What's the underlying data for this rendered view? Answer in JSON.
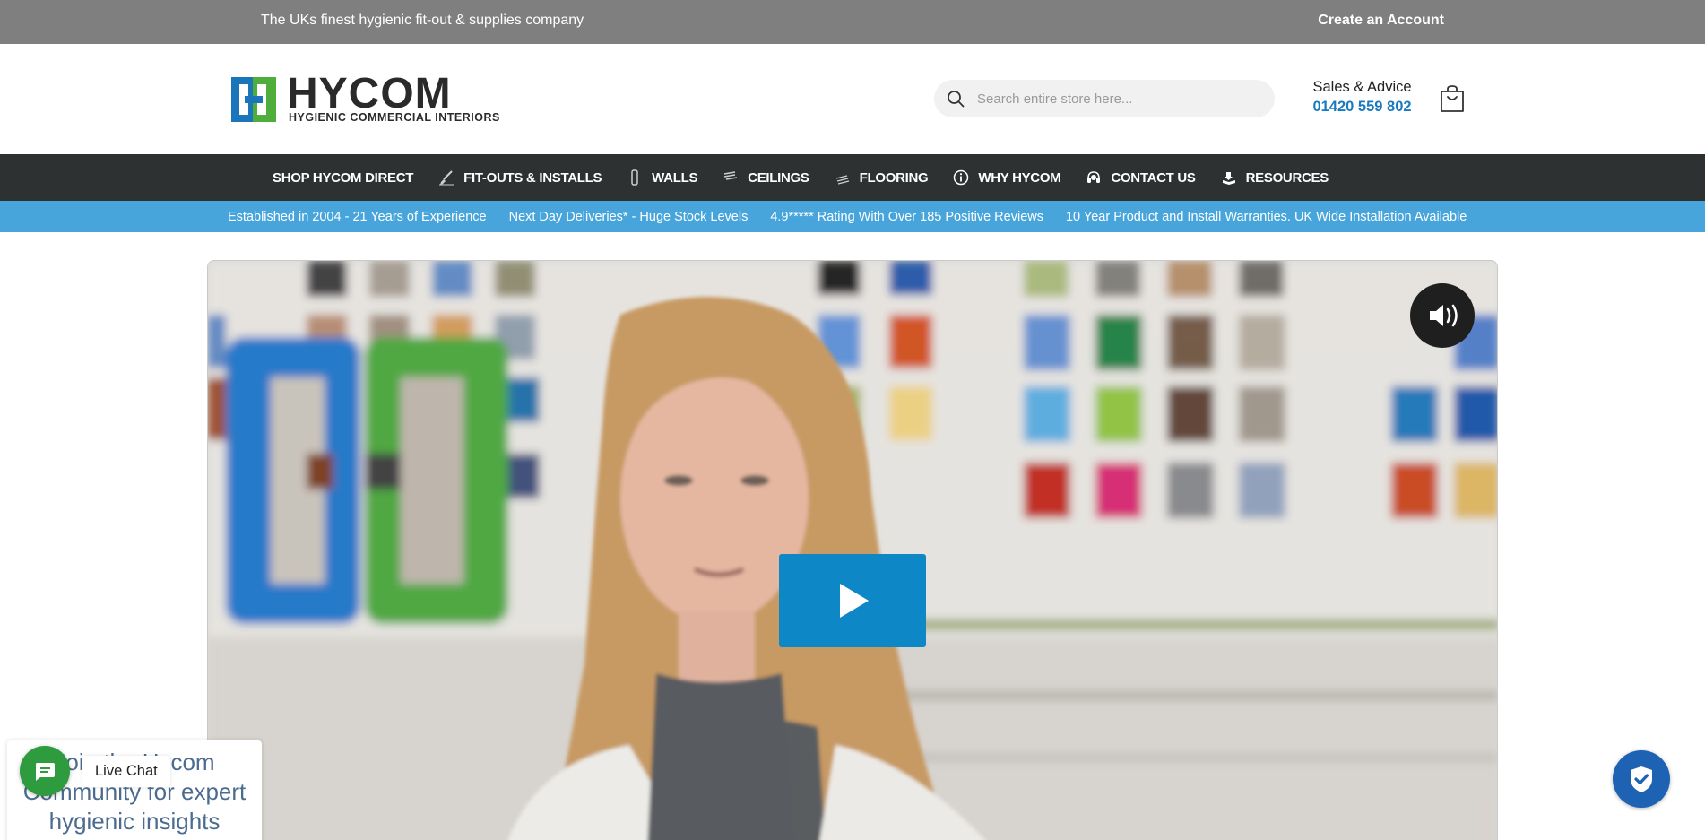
{
  "topbar": {
    "tagline": "The UKs finest hygienic fit-out & supplies company",
    "account_link": "Create an Account"
  },
  "header": {
    "logo_word": "HYCOM",
    "logo_subtitle": "HYGIENIC COMMERCIAL INTERIORS",
    "search_placeholder": "Search entire store here...",
    "sales_label": "Sales & Advice",
    "sales_phone": "01420 559 802"
  },
  "nav": {
    "items": [
      {
        "label": "SHOP HYCOM DIRECT",
        "icon": "none"
      },
      {
        "label": "FIT-OUTS & INSTALLS",
        "icon": "brush-icon"
      },
      {
        "label": "WALLS",
        "icon": "wall-panel-icon"
      },
      {
        "label": "CEILINGS",
        "icon": "ceiling-icon"
      },
      {
        "label": "FLOORING",
        "icon": "flooring-icon"
      },
      {
        "label": "WHY HYCOM",
        "icon": "info-icon"
      },
      {
        "label": "CONTACT US",
        "icon": "headset-icon"
      },
      {
        "label": "RESOURCES",
        "icon": "resources-icon"
      }
    ]
  },
  "usp": {
    "items": [
      "Established in 2004 - 21 Years of Experience",
      "Next Day Deliveries* - Huge Stock Levels",
      "4.9***** Rating With Over 185 Positive Reviews",
      "10 Year Product and Install Warranties. UK Wide Installation Available"
    ]
  },
  "video": {
    "play_icon": "play-icon",
    "sound_icon": "speaker-icon"
  },
  "widgets": {
    "promo_text": "Join the Hycom Community for expert hygienic insights",
    "live_chat_label": "Live Chat",
    "shield_icon": "shield-check-icon"
  },
  "colors": {
    "topbar": "#7f7f7f",
    "nav": "#2d3132",
    "usp_strip": "#47a5dc",
    "accent_blue": "#1a7ac0",
    "play_button": "#0e87c6",
    "chat_green": "#2e9b3e",
    "shield_blue": "#1e62b4",
    "logo_blue": "#1b75bb",
    "logo_green": "#4fae3b"
  }
}
